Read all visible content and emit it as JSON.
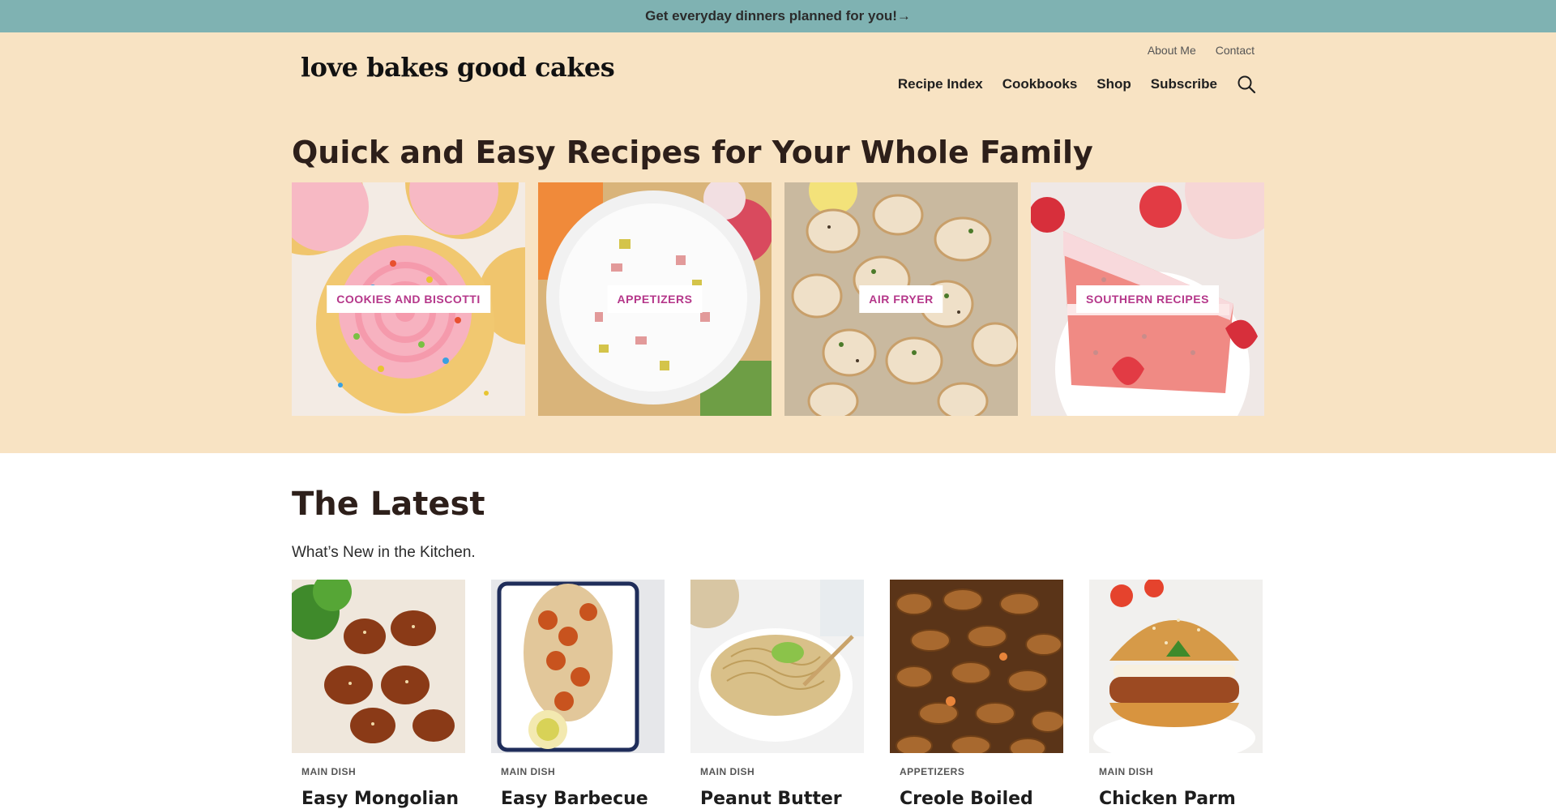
{
  "announcement": {
    "text": "Get everyday dinners planned for you!→"
  },
  "header": {
    "logo": "love bakes good cakes",
    "utility_nav": [
      "About Me",
      "Contact"
    ],
    "main_nav": [
      "Recipe Index",
      "Cookbooks",
      "Shop",
      "Subscribe"
    ],
    "search_icon": "search-icon"
  },
  "hero": {
    "title": "Quick and Easy Recipes for Your Whole Family",
    "categories": [
      {
        "label": "COOKIES AND BISCOTTI",
        "image": "pink frosted sugar cookies with sprinkles"
      },
      {
        "label": "APPETIZERS",
        "image": "white dip bowl with vegetables and pretzels"
      },
      {
        "label": "AIR FRYER",
        "image": "seasoned chicken bites with herbs"
      },
      {
        "label": "SOUTHERN RECIPES",
        "image": "strawberry cake slice with strawberries"
      }
    ],
    "label_color": "#b5378a",
    "background": "#f8e3c3"
  },
  "latest": {
    "title": "The Latest",
    "subtitle": "What’s New in the Kitchen.",
    "posts": [
      {
        "category": "MAIN DISH",
        "title": "Easy Mongolian",
        "image": "glazed chicken with broccoli and rice"
      },
      {
        "category": "MAIN DISH",
        "title": "Easy Barbecue",
        "image": "barbecue shrimp sandwich"
      },
      {
        "category": "MAIN DISH",
        "title": "Peanut Butter",
        "image": "peanut noodles in white bowl with lime"
      },
      {
        "category": "APPETIZERS",
        "title": "Creole Boiled",
        "image": "boiled peanuts"
      },
      {
        "category": "MAIN DISH",
        "title": "Chicken Parm",
        "image": "chicken parmesan burger"
      }
    ]
  },
  "colors": {
    "topbar": "#7fb2b2",
    "hero_bg": "#f8e3c3",
    "heading": "#2d1f1a"
  }
}
